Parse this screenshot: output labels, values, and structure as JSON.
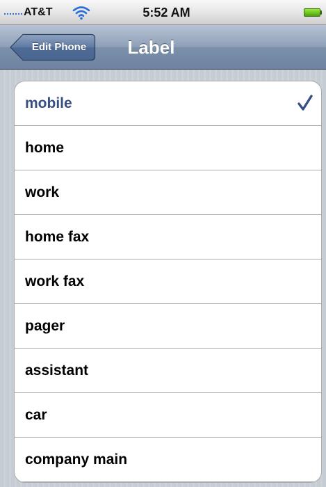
{
  "status_bar": {
    "carrier": "AT&T",
    "time": "5:52 AM"
  },
  "nav_bar": {
    "back_label": "Edit Phone",
    "title": "Label"
  },
  "labels": [
    {
      "label": "mobile",
      "selected": true
    },
    {
      "label": "home",
      "selected": false
    },
    {
      "label": "work",
      "selected": false
    },
    {
      "label": "home fax",
      "selected": false
    },
    {
      "label": "work fax",
      "selected": false
    },
    {
      "label": "pager",
      "selected": false
    },
    {
      "label": "assistant",
      "selected": false
    },
    {
      "label": "car",
      "selected": false
    },
    {
      "label": "company main",
      "selected": false
    }
  ],
  "colors": {
    "selected_text": "#384f84",
    "checkmark": "#384f84",
    "nav_bar": "#8ea0b8",
    "battery": "#6fd121"
  },
  "icons": [
    "signal-icon",
    "wifi-icon",
    "battery-icon",
    "checkmark-icon"
  ]
}
